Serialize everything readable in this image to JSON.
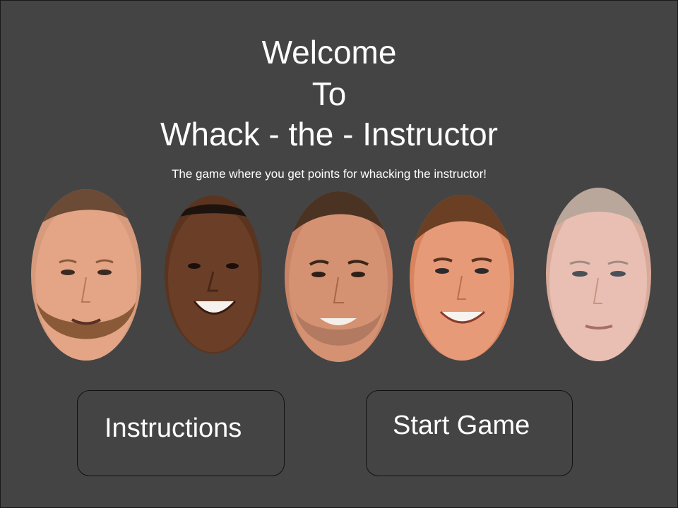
{
  "title": {
    "line1": "Welcome",
    "line2": "To",
    "line3": "Whack - the - Instructor"
  },
  "subtitle": "The game where you get points for whacking the instructor!",
  "faces": [
    {
      "skin": "#e3a585",
      "hair": "#6b4a36",
      "beard": "#8a5a38"
    },
    {
      "skin": "#6b3f27",
      "hair": "#1d130e",
      "beard": null
    },
    {
      "skin": "#d49273",
      "hair": "#4a3322",
      "beard": "#7a5845"
    },
    {
      "skin": "#e69a78",
      "hair": "#6a3f24",
      "beard": null
    },
    {
      "skin": "#e8bfb2",
      "hair": "#b8a79a",
      "beard": null
    }
  ],
  "buttons": {
    "instructions": "Instructions",
    "start": "Start Game"
  },
  "colors": {
    "background": "#444444",
    "text": "#ffffff",
    "button_border": "#111111"
  }
}
